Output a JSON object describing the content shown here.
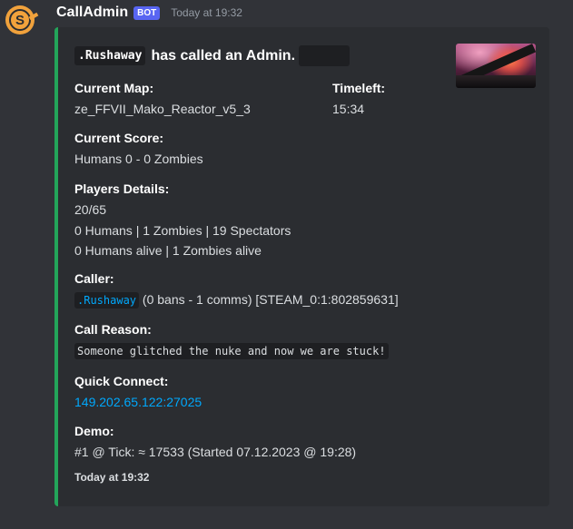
{
  "message": {
    "username": "CallAdmin",
    "badge": "BOT",
    "timestamp": "Today at 19:32",
    "avatar_icon": "s-logo-icon"
  },
  "embed": {
    "accent_color": "#23a55a",
    "title_code": ".Rushaway",
    "title_text": "has called an Admin.",
    "fields": {
      "current_map": {
        "name": "Current Map:",
        "value": "ze_FFVII_Mako_Reactor_v5_3"
      },
      "timeleft": {
        "name": "Timeleft:",
        "value": "15:34"
      },
      "current_score": {
        "name": "Current Score:",
        "value": "Humans 0 - 0 Zombies"
      },
      "players_details": {
        "name": "Players Details:",
        "lines": [
          "20/65",
          "0 Humans | 1 Zombies | 19 Spectators",
          "0 Humans alive | 1 Zombies alive"
        ]
      },
      "caller": {
        "name": "Caller:",
        "code": ".Rushaway",
        "rest": "(0 bans - 1 comms) [STEAM_0:1:802859631]"
      },
      "call_reason": {
        "name": "Call Reason:",
        "value": "Someone glitched the nuke and now we are stuck!"
      },
      "quick_connect": {
        "name": "Quick Connect:",
        "value": "149.202.65.122:27025"
      },
      "demo": {
        "name": "Demo:",
        "value": "#1 @ Tick: ≈ 17533 (Started 07.12.2023 @ 19:28)"
      }
    },
    "footer": "Today at 19:32"
  }
}
